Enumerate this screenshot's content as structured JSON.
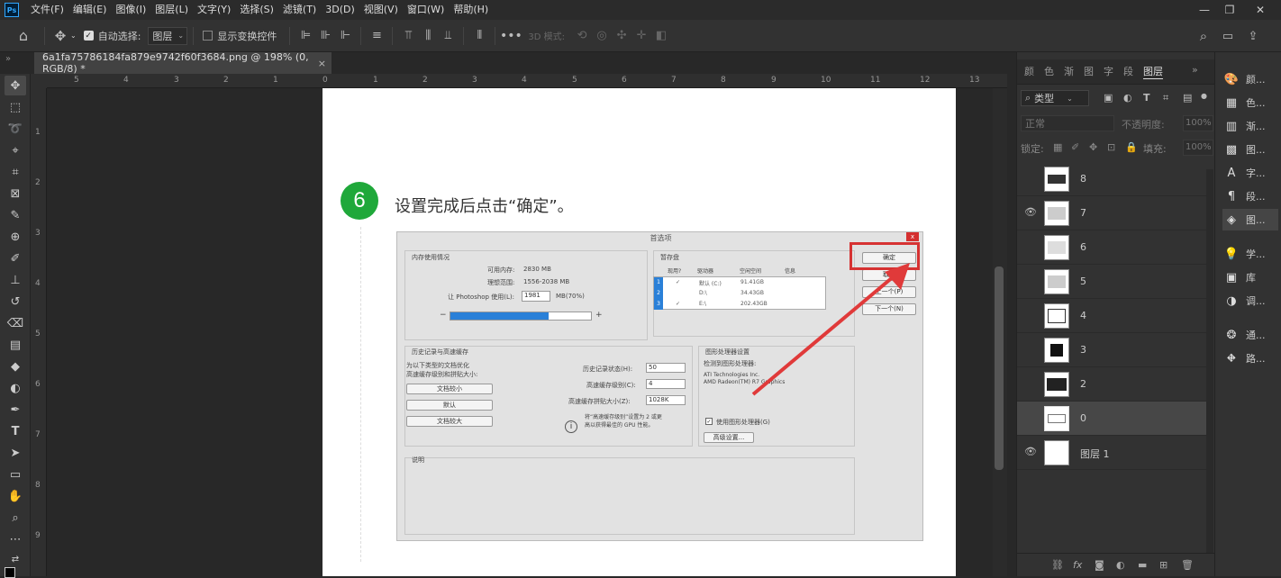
{
  "menubar": {
    "logo": "Ps",
    "items": [
      "文件(F)",
      "编辑(E)",
      "图像(I)",
      "图层(L)",
      "文字(Y)",
      "选择(S)",
      "滤镜(T)",
      "3D(D)",
      "视图(V)",
      "窗口(W)",
      "帮助(H)"
    ],
    "minimize": "—",
    "restore": "❐",
    "close": "✕"
  },
  "options": {
    "auto_select_label": "自动选择:",
    "auto_select_target": "图层",
    "show_transform_label": "显示变换控件",
    "mode_3d_label": "3D 模式:"
  },
  "document_tab": {
    "title": "6a1fa75786184fa879e9742f60f3684.png @ 198% (0, RGB/8) *",
    "close": "×"
  },
  "rulers": {
    "top": [
      "5",
      "4",
      "3",
      "2",
      "1",
      "0",
      "1",
      "2",
      "3",
      "4",
      "5",
      "6",
      "7",
      "8",
      "9",
      "10",
      "11",
      "12",
      "13"
    ],
    "left": [
      "1",
      "2",
      "3",
      "4",
      "5",
      "6",
      "7",
      "8",
      "9"
    ]
  },
  "canvas": {
    "step_number": "6",
    "step_text": "设置完成后点击“确定”。",
    "dialog": {
      "title": "首选项",
      "close": "x",
      "memory_group": "内存使用情况",
      "available_label": "可用内存:",
      "available_value": "2830 MB",
      "ideal_label": "理想范围:",
      "ideal_value": "1556-2038 MB",
      "let_ps_use": "让 Photoshop 使用(L):",
      "let_ps_value": "1981",
      "let_ps_unit": "MB(70%)",
      "minus": "−",
      "plus": "+",
      "scratch_group": "暂存盘",
      "scratch_headers": [
        "现用?",
        "驱动器",
        "空闲空间",
        "信息"
      ],
      "scratch_rows": [
        {
          "num": "1",
          "check": "✓",
          "drive": "默认 (C:)",
          "space": "91.41GB"
        },
        {
          "num": "2",
          "check": "",
          "drive": "D:\\",
          "space": "34.43GB"
        },
        {
          "num": "3",
          "check": "✓",
          "drive": "E:\\",
          "space": "202.43GB"
        }
      ],
      "history_group": "历史记录与高速缓存",
      "history_desc_1": "为以下类型的文档优化",
      "history_desc_2": "高速缓存级别和拼贴大小:",
      "btn_small": "文档较小",
      "btn_default": "默认",
      "btn_large": "文档较大",
      "history_states_label": "历史记录状态(H):",
      "history_states_value": "50",
      "cache_levels_label": "高速缓存级别(C):",
      "cache_levels_value": "4",
      "tile_size_label": "高速缓存拼贴大小(Z):",
      "tile_size_value": "1028K",
      "info_note_1": "将“高速缓存级别”设置为 2 或更",
      "info_note_2": "高以获得最佳的 GPU 性能。",
      "gpu_group": "图形处理器设置",
      "gpu_detected": "检测到图形处理器:",
      "gpu_line1": "ATI Technologies Inc.",
      "gpu_line2": "AMD Radeon(TM) R7 Graphics",
      "use_gpu": "使用图形处理器(G)",
      "advanced_btn": "高级设置...",
      "description_group": "说明",
      "ok": "确定",
      "cancel": "取消",
      "prev": "上一个(P)",
      "next": "下一个(N)"
    }
  },
  "layers_panel": {
    "tabs": [
      "颜",
      "色",
      "渐",
      "图",
      "字",
      "段",
      "图层"
    ],
    "filter_kind": "类型",
    "blend_mode": "正常",
    "opacity_label": "不透明度:",
    "opacity_value": "100%",
    "lock_label": "锁定:",
    "fill_label": "填充:",
    "fill_value": "100%",
    "layers": [
      {
        "name": "8",
        "visible": false
      },
      {
        "name": "7",
        "visible": true
      },
      {
        "name": "6",
        "visible": false
      },
      {
        "name": "5",
        "visible": false
      },
      {
        "name": "4",
        "visible": false
      },
      {
        "name": "3",
        "visible": false
      },
      {
        "name": "2",
        "visible": false
      },
      {
        "name": "0",
        "visible": false
      },
      {
        "name": "图层 1",
        "visible": true
      }
    ]
  },
  "side_panel": {
    "items": [
      "颜...",
      "色...",
      "渐...",
      "图...",
      "字...",
      "段...",
      "图...",
      "学...",
      "库",
      "调...",
      "通...",
      "路..."
    ]
  },
  "colors": {
    "accent_red": "#d63232",
    "step_green": "#1fa83a",
    "selection_blue": "#2a80d8"
  }
}
